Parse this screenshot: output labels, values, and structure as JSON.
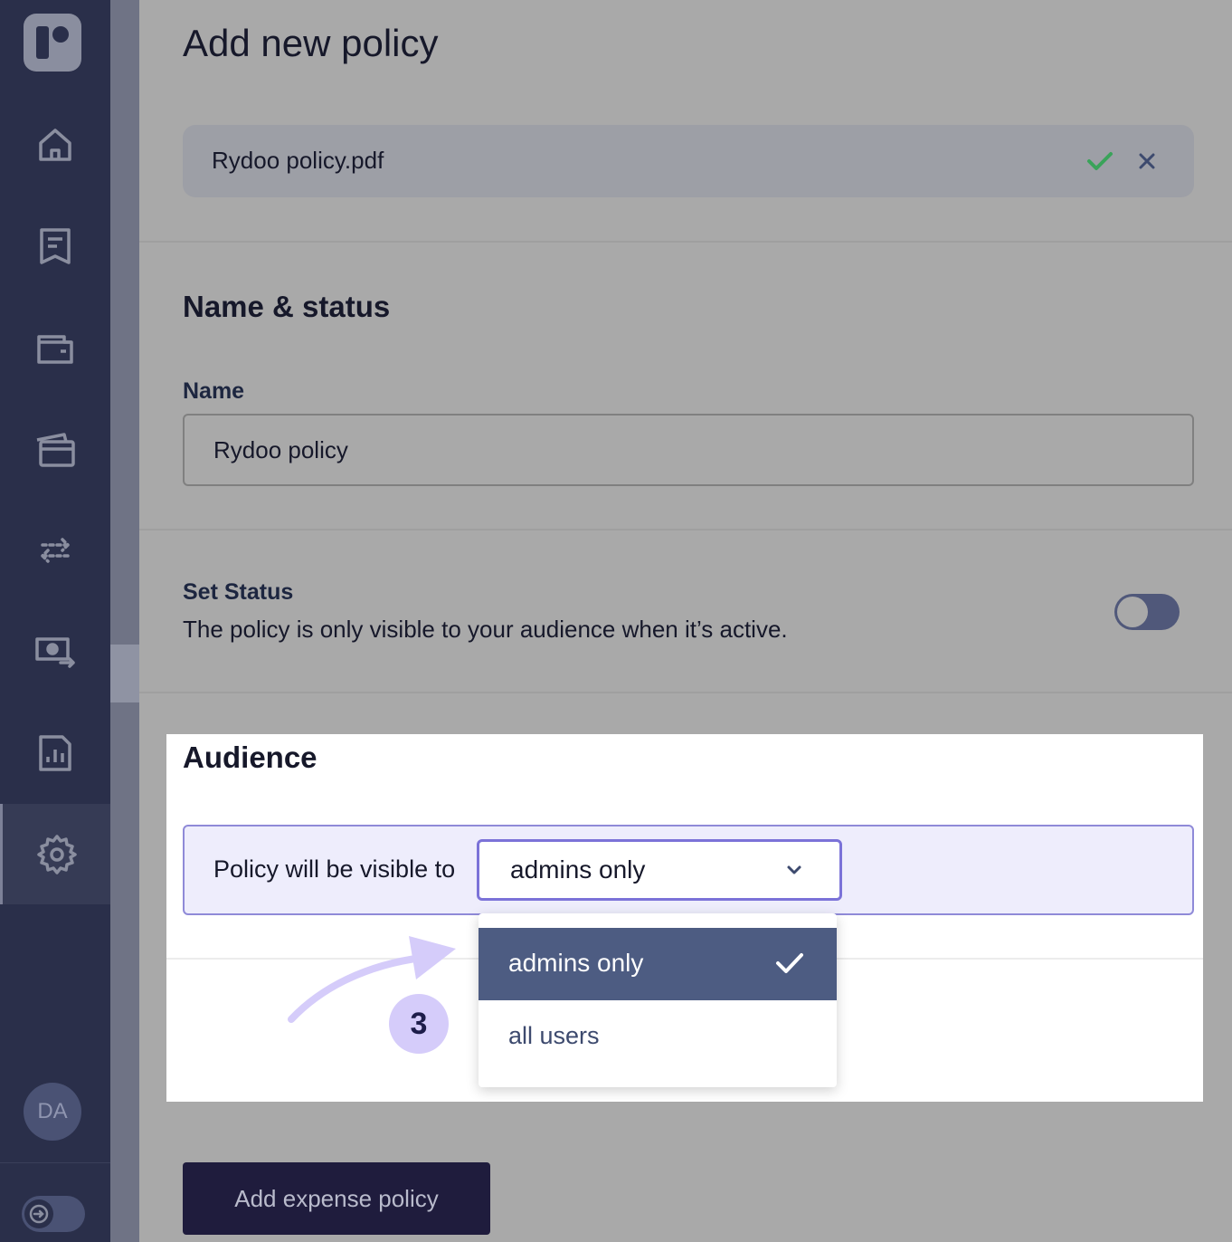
{
  "sidebar": {
    "items": [
      {
        "icon": "home-icon"
      },
      {
        "icon": "receipt-icon"
      },
      {
        "icon": "wallet-icon"
      },
      {
        "icon": "cards-icon"
      },
      {
        "icon": "transfer-arrows-icon"
      },
      {
        "icon": "reimbursement-icon"
      },
      {
        "icon": "reports-icon"
      },
      {
        "icon": "gear-icon",
        "active": true
      }
    ],
    "avatar_initials": "DA"
  },
  "page": {
    "title": "Add new policy"
  },
  "file": {
    "name": "Rydoo policy.pdf"
  },
  "name_status": {
    "section_title": "Name & status",
    "name_label": "Name",
    "name_value": "Rydoo policy",
    "status_label": "Set Status",
    "status_description": "The policy is only visible to your audience when it’s active.",
    "status_active": false
  },
  "audience": {
    "section_title": "Audience",
    "visible_label": "Policy will be visible to",
    "selected_value": "admins only",
    "options": [
      {
        "label": "admins only",
        "selected": true
      },
      {
        "label": "all users",
        "selected": false
      }
    ]
  },
  "annotation": {
    "step_number": "3"
  },
  "actions": {
    "submit_label": "Add expense policy"
  },
  "colors": {
    "sidebar": "#2a2f4a",
    "primary_button": "#1f1c3d",
    "selected_option": "#4d5c82",
    "highlight_border": "#7b72d8",
    "success_check": "#3aa35a"
  }
}
